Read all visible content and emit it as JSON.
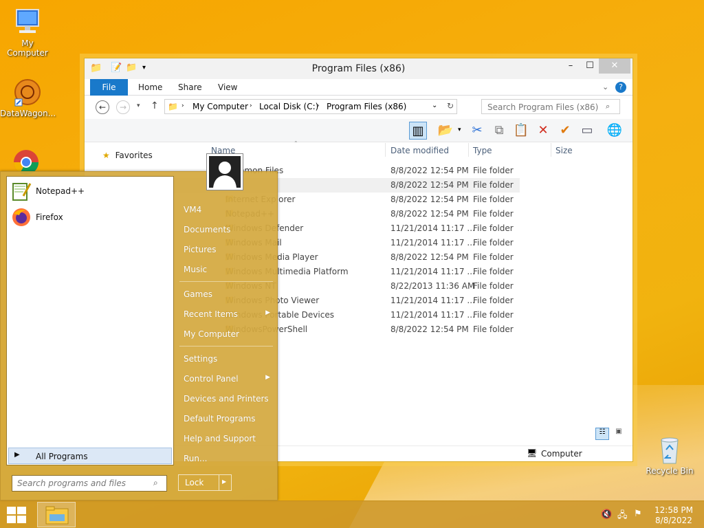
{
  "desktop": {
    "icons": [
      {
        "label": "My Computer"
      },
      {
        "label": "DataWagon..."
      },
      {
        "label": "Recycle Bin"
      }
    ]
  },
  "explorer": {
    "title": "Program Files (x86)",
    "tabs": [
      "File",
      "Home",
      "Share",
      "View"
    ],
    "address": {
      "parts": [
        "My Computer",
        "Local Disk (C:)",
        "Program Files (x86)"
      ]
    },
    "search_placeholder": "Search Program Files (x86)",
    "nav_favorites": "Favorites",
    "columns": [
      "Name",
      "Date modified",
      "Type",
      "Size"
    ],
    "rows": [
      {
        "name": "Common Files",
        "date": "8/8/2022 12:54 PM",
        "type": "File folder"
      },
      {
        "name": "",
        "date": "8/8/2022 12:54 PM",
        "type": "File folder"
      },
      {
        "name": "Internet Explorer",
        "date": "8/8/2022 12:54 PM",
        "type": "File folder"
      },
      {
        "name": "Notepad++",
        "date": "8/8/2022 12:54 PM",
        "type": "File folder"
      },
      {
        "name": "Windows Defender",
        "date": "11/21/2014 11:17 ...",
        "type": "File folder"
      },
      {
        "name": "Windows Mail",
        "date": "11/21/2014 11:17 ...",
        "type": "File folder"
      },
      {
        "name": "Windows Media Player",
        "date": "8/8/2022 12:54 PM",
        "type": "File folder"
      },
      {
        "name": "Windows Multimedia Platform",
        "date": "11/21/2014 11:17 ...",
        "type": "File folder"
      },
      {
        "name": "Windows NT",
        "date": "8/22/2013 11:36 AM",
        "type": "File folder"
      },
      {
        "name": "Windows Photo Viewer",
        "date": "11/21/2014 11:17 ...",
        "type": "File folder"
      },
      {
        "name": "Windows Portable Devices",
        "date": "11/21/2014 11:17 ...",
        "type": "File folder"
      },
      {
        "name": "WindowsPowerShell",
        "date": "8/8/2022 12:54 PM",
        "type": "File folder"
      }
    ],
    "status_location": "Computer"
  },
  "start_menu": {
    "pinned": [
      {
        "label": "Notepad++"
      },
      {
        "label": "Firefox"
      }
    ],
    "all_programs": "All Programs",
    "search_placeholder": "Search programs and files",
    "right": [
      {
        "label": "VM4"
      },
      {
        "label": "Documents"
      },
      {
        "label": "Pictures"
      },
      {
        "label": "Music"
      },
      {
        "label": "Games"
      },
      {
        "label": "Recent Items"
      },
      {
        "label": "My Computer"
      },
      {
        "label": "Settings"
      },
      {
        "label": "Control Panel"
      },
      {
        "label": "Devices and Printers"
      },
      {
        "label": "Default Programs"
      },
      {
        "label": "Help and Support"
      },
      {
        "label": "Run..."
      }
    ],
    "lock_label": "Lock"
  },
  "taskbar": {
    "time": "12:58 PM",
    "date": "8/8/2022"
  }
}
